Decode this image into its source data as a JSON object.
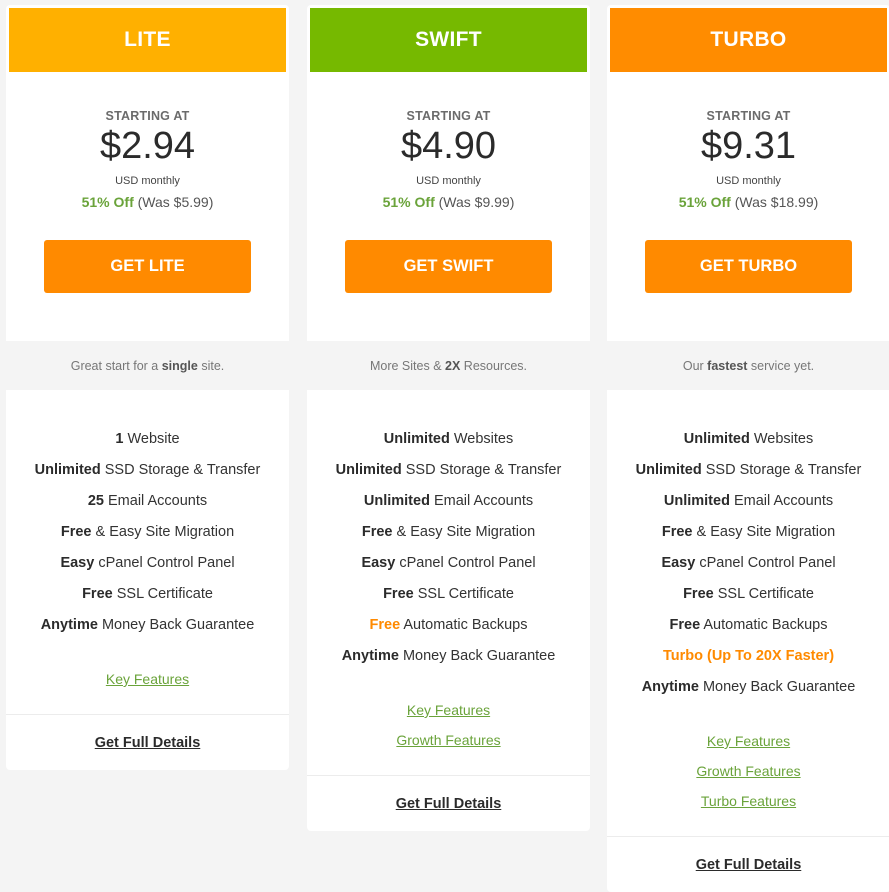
{
  "plans": [
    {
      "name": "LITE",
      "header_color": "#ffb000",
      "starting_label": "STARTING AT",
      "price": "$2.94",
      "period": "USD monthly",
      "discount": "51% Off",
      "was_prefix": "(Was ",
      "was_price": "$5.99",
      "was_suffix": ")",
      "cta_label": "GET LITE",
      "tagline": {
        "pre": "Great start for a ",
        "bold": "single",
        "post": " site."
      },
      "features": [
        {
          "bold": "1",
          "text": " Website"
        },
        {
          "bold": "Unlimited",
          "text": " SSD Storage & Transfer"
        },
        {
          "bold": "25",
          "text": " Email Accounts"
        },
        {
          "bold": "Free",
          "text": " & Easy Site Migration"
        },
        {
          "bold": "Easy",
          "text": " cPanel Control Panel"
        },
        {
          "bold": "Free",
          "text": " SSL Certificate"
        },
        {
          "bold": "Anytime",
          "text": " Money Back Guarantee"
        }
      ],
      "links": [
        "Key Features"
      ],
      "details_label": "Get Full Details"
    },
    {
      "name": "SWIFT",
      "header_color": "#76b900",
      "starting_label": "STARTING AT",
      "price": "$4.90",
      "period": "USD monthly",
      "discount": "51% Off",
      "was_prefix": "(Was ",
      "was_price": "$9.99",
      "was_suffix": ")",
      "cta_label": "GET SWIFT",
      "tagline": {
        "pre": "More Sites & ",
        "bold": "2X",
        "post": " Resources."
      },
      "features": [
        {
          "bold": "Unlimited",
          "text": " Websites"
        },
        {
          "bold": "Unlimited",
          "text": " SSD Storage & Transfer"
        },
        {
          "bold": "Unlimited",
          "text": " Email Accounts"
        },
        {
          "bold": "Free",
          "text": " & Easy Site Migration"
        },
        {
          "bold": "Easy",
          "text": " cPanel Control Panel"
        },
        {
          "bold": "Free",
          "text": " SSL Certificate"
        },
        {
          "bold": "Free",
          "text": " Automatic Backups",
          "bold_highlight": true
        },
        {
          "bold": "Anytime",
          "text": " Money Back Guarantee"
        }
      ],
      "links": [
        "Key Features",
        "Growth Features"
      ],
      "details_label": "Get Full Details"
    },
    {
      "name": "TURBO",
      "header_color": "#ff8c00",
      "starting_label": "STARTING AT",
      "price": "$9.31",
      "period": "USD monthly",
      "discount": "51% Off",
      "was_prefix": "(Was ",
      "was_price": "$18.99",
      "was_suffix": ")",
      "cta_label": "GET TURBO",
      "tagline": {
        "pre": "Our ",
        "bold": "fastest",
        "post": " service yet."
      },
      "features": [
        {
          "bold": "Unlimited",
          "text": " Websites"
        },
        {
          "bold": "Unlimited",
          "text": " SSD Storage & Transfer"
        },
        {
          "bold": "Unlimited",
          "text": " Email Accounts"
        },
        {
          "bold": "Free",
          "text": " & Easy Site Migration"
        },
        {
          "bold": "Easy",
          "text": " cPanel Control Panel"
        },
        {
          "bold": "Free",
          "text": " SSL Certificate"
        },
        {
          "bold": "Free",
          "text": " Automatic Backups"
        },
        {
          "bold": "Turbo (Up To 20X Faster)",
          "text": "",
          "full_highlight": true
        },
        {
          "bold": "Anytime",
          "text": " Money Back Guarantee"
        }
      ],
      "links": [
        "Key Features",
        "Growth Features",
        "Turbo Features"
      ],
      "details_label": "Get Full Details"
    }
  ],
  "colors": {
    "cta": "#ff8a00",
    "discount_green": "#6aa33a",
    "link_green": "#6aa33a",
    "highlight_orange": "#ff8a00"
  }
}
